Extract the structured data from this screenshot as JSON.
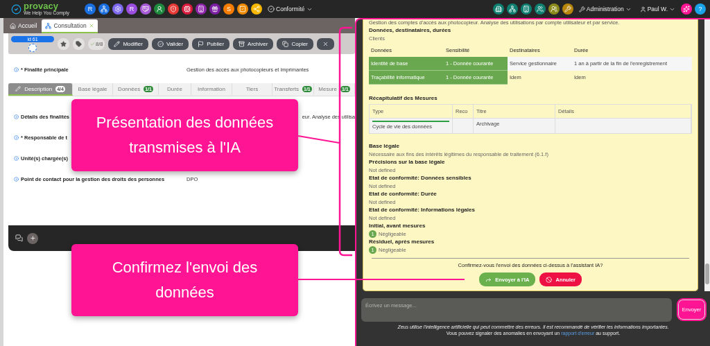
{
  "top_bar": {
    "logo": {
      "name": "provacy",
      "tagline": "We Help You Comply"
    },
    "app_icons": [
      {
        "label": "R",
        "color": "#1a6fe0"
      },
      {
        "color": "#1a6fe0"
      },
      {
        "color": "#7b68ee"
      },
      {
        "label": "R",
        "color": "#9b4de0"
      },
      {
        "color": "#a85bd6"
      },
      {
        "color": "#1e8a3e"
      },
      {
        "color": "#e53935"
      },
      {
        "color": "#d81b3c"
      },
      {
        "color": "#8e24aa"
      },
      {
        "color": "#7b1fa2"
      },
      {
        "label": "S",
        "color": "#f57c00"
      },
      {
        "color": "#ef8a00"
      },
      {
        "color": "#f9b800"
      }
    ],
    "menu": "Conformité",
    "tool_icons": [
      {
        "color": "#0e7f70"
      },
      {
        "color": "#0e7f70"
      },
      {
        "color": "#0e7f70"
      },
      {
        "color": "#0e7f70"
      },
      {
        "color": "#8c8a1c"
      },
      {
        "color": "#b8860b"
      }
    ],
    "admin_menu": "Administration",
    "user_menu": "Paul W.",
    "help": "?"
  },
  "tabs": [
    {
      "label": "Accueil",
      "selected": false
    },
    {
      "label": "Consultation",
      "selected": true
    }
  ],
  "record": {
    "id": "id 61",
    "progress": "8/8",
    "buttons": [
      {
        "label": "Modifier"
      },
      {
        "label": "Valider"
      },
      {
        "label": "Publier"
      },
      {
        "label": "Archiver"
      },
      {
        "label": "Copier"
      }
    ]
  },
  "main_field": {
    "label": "* Finalité principale",
    "value": "Gestion des accès aux photocopieurs et imprimantes"
  },
  "section_tabs": [
    {
      "label": "Description",
      "badge": "4/4",
      "selected": true
    },
    {
      "label": "Base légale",
      "selected": false
    },
    {
      "label": "Données",
      "badge": "1/1",
      "selected": false
    },
    {
      "label": "Durée",
      "selected": false
    },
    {
      "label": "Information",
      "selected": false
    },
    {
      "label": "Tiers",
      "selected": false
    },
    {
      "label": "Transferts",
      "badge": "1/1",
      "selected": false
    },
    {
      "label": "Mesure",
      "badge": "1/1",
      "selected": false
    }
  ],
  "fields": [
    {
      "label": "Détails des finalités",
      "value": "eur. Analyse des utilisa",
      "kind": "covered"
    },
    {
      "label": "* Responsable de t",
      "kind": "covered"
    },
    {
      "label": "Unité(s) chargée(s)",
      "kind": "covered"
    },
    {
      "label": "Point de contact pour la gestion des droits des personnes",
      "value": "DPO",
      "kind": "field"
    }
  ],
  "chat": {
    "card": {
      "intro": "Gestion des comptes d'accès aux photocopieur. Analyse des utilisations par compte utilisateur et par service.",
      "data_heading": "Données, destinataires, durées",
      "category": "Clients",
      "data_table": {
        "columns": [
          "Données",
          "Sensibilité",
          "Destinataires",
          "Durée"
        ],
        "rows": [
          {
            "cells": [
              "Identité de base",
              "1 - Donnée courante",
              "Service gestionnaire",
              "1 an à partir de la fin de l'enregistrement"
            ]
          },
          {
            "cells": [
              "Traçabilité informatique",
              "1 - Donnée courante",
              "Idem",
              "Idem"
            ]
          }
        ]
      },
      "measures_heading": "Récapitulatif des Mesures",
      "measures_table": {
        "columns": [
          "Type",
          "Reco",
          "Titre",
          "Détails"
        ],
        "rows": [
          {
            "type": "Cycle de vie des données",
            "title": "Archivage",
            "color": "#2e9e44"
          }
        ]
      },
      "sections": [
        {
          "label": "Base légale",
          "value": "Nécessaire aux fins des intérêts légitimes du responsable de traitement (6.1.f)",
          "kind": "text"
        },
        {
          "label": "Précisions sur la base légale",
          "value": "Not defined",
          "kind": "text"
        },
        {
          "label": "Etat de conformité: Données sensibles",
          "value": "Not defined",
          "kind": "text"
        },
        {
          "label": "Etat de conformité: Durée",
          "value": "Not defined",
          "kind": "text"
        },
        {
          "label": "Etat de conformité: Informations légales",
          "value": "Not defined",
          "kind": "text"
        },
        {
          "label": "Initial, avant mesures",
          "level": "1",
          "value": "Négligeable",
          "kind": "risk"
        },
        {
          "label": "Résiduel, après mesures",
          "level": "1",
          "value": "Négligeable",
          "kind": "risk"
        }
      ],
      "question": "Confirmez-vous l'envoi des données ci-dessus à l'assistant IA?",
      "buttons": [
        {
          "label": "Envoyer à l'IA",
          "kind": "confirm"
        },
        {
          "label": "Annuler",
          "kind": "cancel"
        }
      ]
    },
    "composer": {
      "placeholder": "Écrivez un message...",
      "send": "Envoyer"
    },
    "disclaimer": {
      "line1": "Zeus utilise l'intelligence artificielle qui peut commettre des erreurs. Il est recommandé de vérifier les informations importantes.",
      "before": "Vous pouvez signaler des anomalies en envoyant un",
      "link": "rapport d'erreur",
      "after": "au support."
    }
  },
  "annotations": [
    {
      "text": "Présentation des données transmises à l'IA"
    },
    {
      "text": "Confirmez l'envoi des données"
    }
  ]
}
